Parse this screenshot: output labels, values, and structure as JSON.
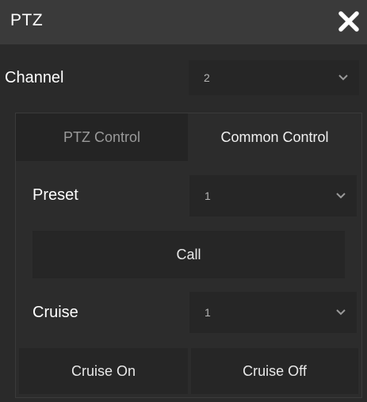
{
  "dialog": {
    "title": "PTZ",
    "close_icon": "close-icon"
  },
  "channel": {
    "label": "Channel",
    "value": "2"
  },
  "tabs": [
    {
      "label": "PTZ Control",
      "selected": false
    },
    {
      "label": "Common Control",
      "selected": true
    }
  ],
  "preset": {
    "label": "Preset",
    "value": "1",
    "call_label": "Call"
  },
  "cruise": {
    "label": "Cruise",
    "value": "1",
    "on_label": "Cruise On",
    "off_label": "Cruise Off"
  },
  "colors": {
    "background": "#2a2a2a",
    "titlebar": "#3a3a3a",
    "control": "#262626",
    "text": "#ffffff"
  }
}
